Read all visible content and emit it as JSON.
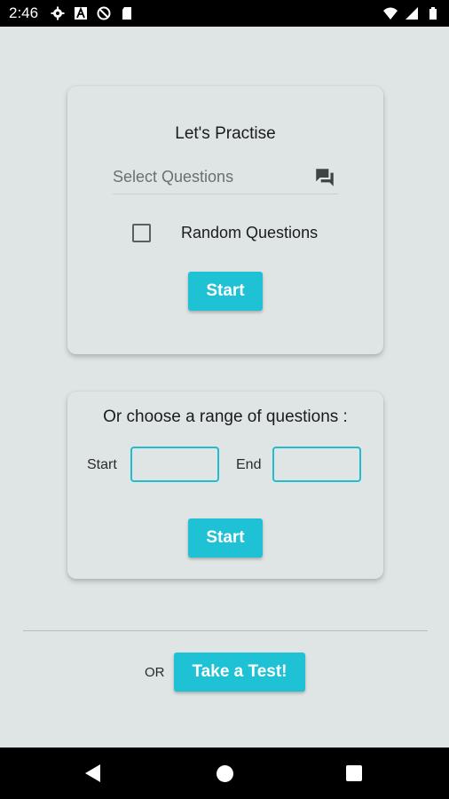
{
  "status_bar": {
    "time": "2:46"
  },
  "practice_card": {
    "title": "Let's Practise",
    "select_placeholder": "Select Questions",
    "random_label": "Random Questions",
    "random_checked": false,
    "start_label": "Start"
  },
  "range_card": {
    "title": "Or choose a range of questions :",
    "start_field_label": "Start",
    "end_field_label": "End",
    "start_value": "",
    "end_value": "",
    "start_label": "Start"
  },
  "footer": {
    "or_label": "OR",
    "test_button_label": "Take a Test!"
  },
  "colors": {
    "accent": "#1ec2d4",
    "background": "#dfe5e5"
  },
  "icons": {
    "select": "chat-bubbles-icon",
    "status_left": [
      "settings-gear-icon",
      "a-square-icon",
      "no-sync-icon",
      "sd-card-icon"
    ],
    "status_right": [
      "wifi-icon",
      "signal-icon",
      "battery-icon"
    ],
    "nav": [
      "back-icon",
      "home-icon",
      "recents-icon"
    ]
  }
}
